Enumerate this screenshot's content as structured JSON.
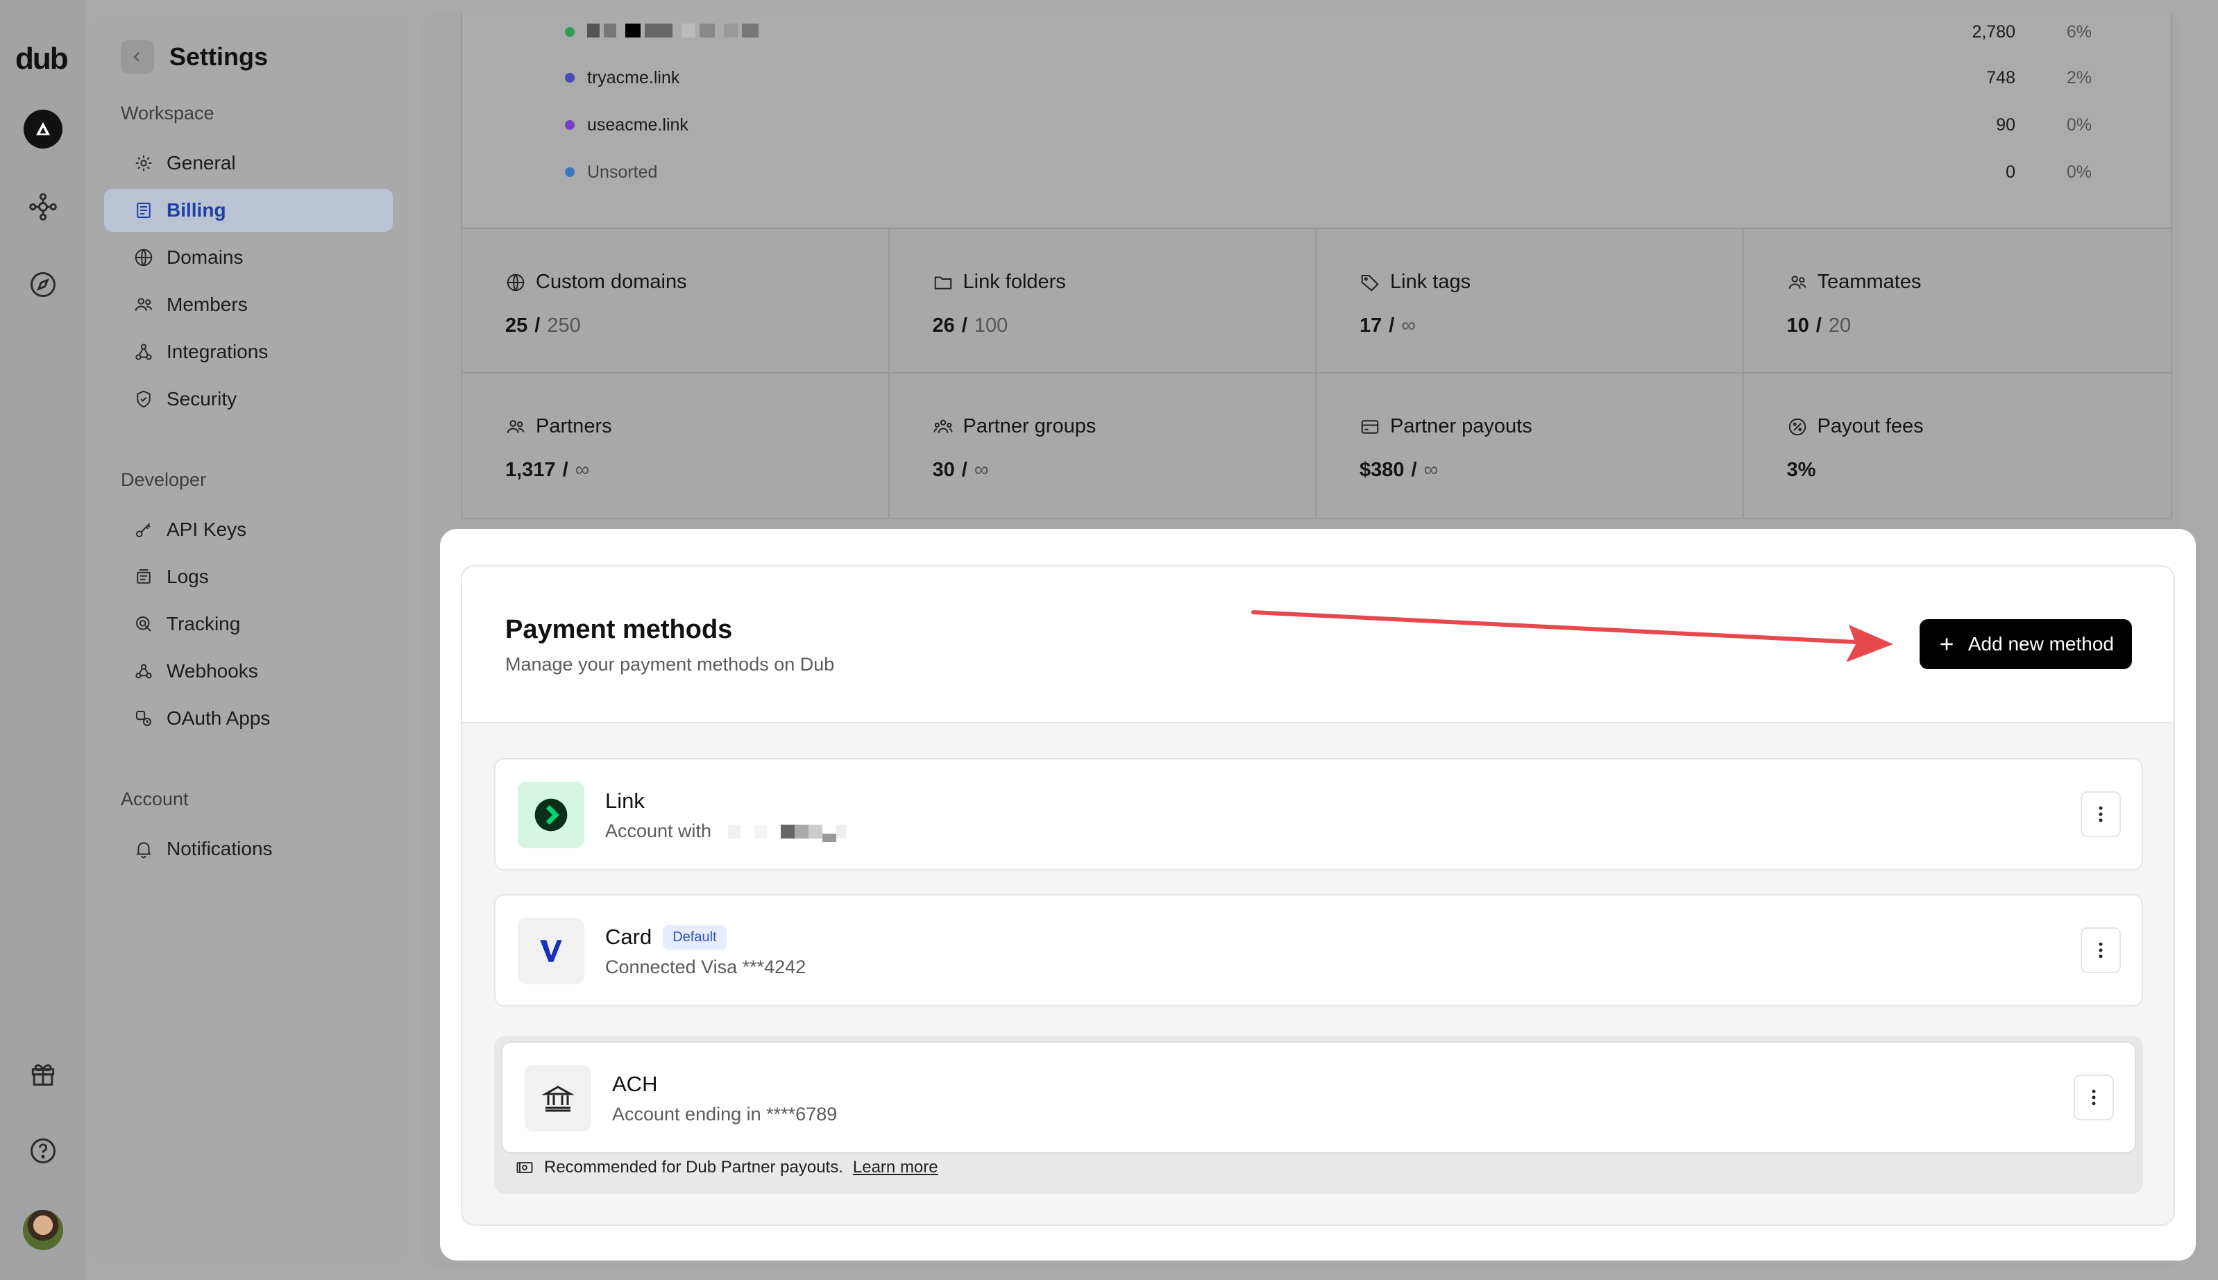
{
  "brand": {
    "logo": "dub"
  },
  "rail": {
    "icons": [
      "workspace-avatar",
      "connections-icon",
      "compass-icon",
      "gift-icon",
      "help-icon",
      "user-avatar"
    ]
  },
  "sidebar": {
    "title": "Settings",
    "sections": [
      {
        "label": "Workspace",
        "items": [
          {
            "label": "General",
            "icon": "gear-icon"
          },
          {
            "label": "Billing",
            "icon": "receipt-icon",
            "active": true
          },
          {
            "label": "Domains",
            "icon": "globe-icon"
          },
          {
            "label": "Members",
            "icon": "users-icon"
          },
          {
            "label": "Integrations",
            "icon": "integrations-icon"
          },
          {
            "label": "Security",
            "icon": "shield-icon"
          }
        ]
      },
      {
        "label": "Developer",
        "items": [
          {
            "label": "API Keys",
            "icon": "key-icon"
          },
          {
            "label": "Logs",
            "icon": "logs-icon"
          },
          {
            "label": "Tracking",
            "icon": "tracking-icon"
          },
          {
            "label": "Webhooks",
            "icon": "webhook-icon"
          },
          {
            "label": "OAuth Apps",
            "icon": "oauth-icon"
          }
        ]
      },
      {
        "label": "Account",
        "items": [
          {
            "label": "Notifications",
            "icon": "bell-icon"
          }
        ]
      }
    ]
  },
  "domains_breakdown": {
    "rows": [
      {
        "name": "",
        "count": "2,780",
        "pct": "6%",
        "color": "#2e9d57"
      },
      {
        "name": "tryacme.link",
        "count": "748",
        "pct": "2%",
        "color": "#4a4ab8"
      },
      {
        "name": "useacme.link",
        "count": "90",
        "pct": "0%",
        "color": "#7c3fc4"
      },
      {
        "name": "Unsorted",
        "count": "0",
        "pct": "0%",
        "color": "#3a78c4"
      }
    ]
  },
  "stats": [
    {
      "label": "Custom domains",
      "icon": "globe-icon",
      "value": "25",
      "limit": "250"
    },
    {
      "label": "Link folders",
      "icon": "folder-icon",
      "value": "26",
      "limit": "100"
    },
    {
      "label": "Link tags",
      "icon": "tag-icon",
      "value": "17",
      "limit": "∞"
    },
    {
      "label": "Teammates",
      "icon": "users-icon",
      "value": "10",
      "limit": "20"
    },
    {
      "label": "Partners",
      "icon": "users-icon",
      "value": "1,317",
      "limit": "∞"
    },
    {
      "label": "Partner groups",
      "icon": "groups-icon",
      "value": "30",
      "limit": "∞"
    },
    {
      "label": "Partner payouts",
      "icon": "card-icon",
      "value": "$380",
      "limit": "∞"
    },
    {
      "label": "Payout fees",
      "icon": "percent-icon",
      "value": "3%",
      "limit": ""
    }
  ],
  "payment_methods": {
    "title": "Payment methods",
    "subtitle": "Manage your payment methods on Dub",
    "add_button": "Add new method",
    "methods": [
      {
        "name": "Link",
        "detail": "Account with",
        "badge": ""
      },
      {
        "name": "Card",
        "detail": "Connected Visa ***4242",
        "badge": "Default"
      },
      {
        "name": "ACH",
        "detail": "Account ending in ****6789",
        "badge": ""
      }
    ],
    "ach_note": "Recommended for Dub Partner payouts.",
    "ach_note_link": "Learn more"
  },
  "colors": {
    "accent_active": "#1f3fa8",
    "annotation_arrow": "#e5484d",
    "link_brand": "#00d66f"
  }
}
